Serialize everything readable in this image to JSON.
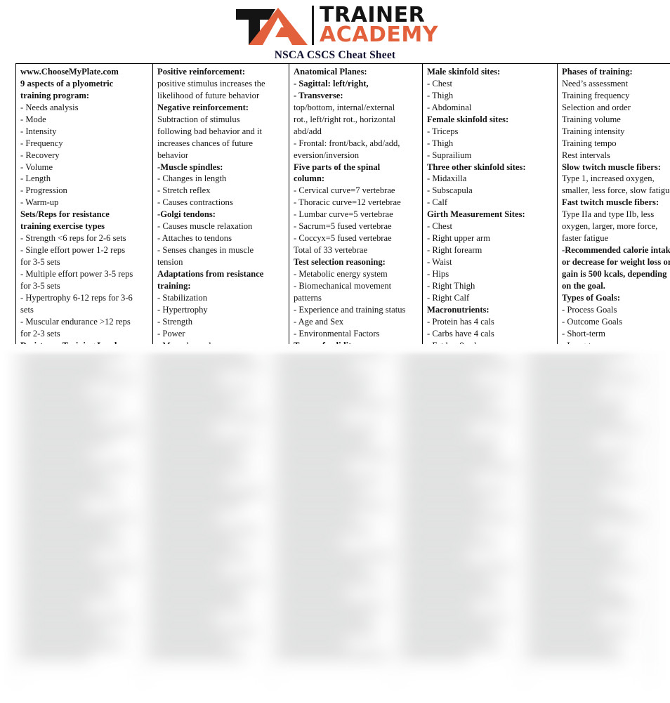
{
  "header": {
    "logo_icon": "trainer-academy-logo",
    "logo_word_1": "TRAINER",
    "logo_word_2": "ACADEMY",
    "subtitle": "NSCA CSCS Cheat Sheet",
    "brand_orange": "#e2613c",
    "brand_black": "#141414",
    "subtitle_color": "#101030"
  },
  "columns": [
    {
      "id": "column-1",
      "lines": [
        {
          "text": "www.ChooseMyPlate.com",
          "bold": true
        },
        {
          "text": "9 aspects of a plyometric",
          "bold": true
        },
        {
          "text": "training program:",
          "bold": true
        },
        {
          "text": "- Needs analysis",
          "bold": false
        },
        {
          "text": "- Mode",
          "bold": false
        },
        {
          "text": "- Intensity",
          "bold": false
        },
        {
          "text": "- Frequency",
          "bold": false
        },
        {
          "text": "- Recovery",
          "bold": false
        },
        {
          "text": "- Volume",
          "bold": false
        },
        {
          "text": "- Length",
          "bold": false
        },
        {
          "text": "- Progression",
          "bold": false
        },
        {
          "text": "- Warm-up",
          "bold": false
        },
        {
          "text": "Sets/Reps for resistance",
          "bold": true
        },
        {
          "text": "training exercise types",
          "bold": true
        },
        {
          "text": "- Strength <6 reps for 2-6 sets",
          "bold": false
        },
        {
          "text": "- Single effort power 1-2 reps",
          "bold": false
        },
        {
          "text": "for 3-5 sets",
          "bold": false
        },
        {
          "text": "- Multiple effort power 3-5 reps",
          "bold": false
        },
        {
          "text": "for 3-5 sets",
          "bold": false
        },
        {
          "text": "- Hypertrophy 6-12 reps for 3-6",
          "bold": false
        },
        {
          "text": "sets",
          "bold": false
        },
        {
          "text": "- Muscular endurance >12 reps",
          "bold": false
        },
        {
          "text": "for 2-3 sets",
          "bold": false
        },
        {
          "text": "Resistance Training Load",
          "bold": true
        },
        {
          "text": "- Strength >85% 1RM",
          "bold": false
        },
        {
          "text": "- Power single effort 80-90%",
          "bold": false
        },
        {
          "text": "1RM",
          "bold": false
        }
      ]
    },
    {
      "id": "column-2",
      "lines": [
        {
          "text": "Positive reinforcement:",
          "bold": true
        },
        {
          "text": "positive stimulus increases the",
          "bold": false
        },
        {
          "text": "likelihood of future behavior",
          "bold": false
        },
        {
          "text": "Negative reinforcement:",
          "bold": true
        },
        {
          "text": "Subtraction of stimulus",
          "bold": false
        },
        {
          "text": "following bad behavior and it",
          "bold": false
        },
        {
          "text": "increases chances of future",
          "bold": false
        },
        {
          "text": "behavior",
          "bold": false
        },
        {
          "text": "-Muscle spindles:",
          "bold": true
        },
        {
          "text": "- Changes in length",
          "bold": false
        },
        {
          "text": "- Stretch reflex",
          "bold": false
        },
        {
          "text": "- Causes contractions",
          "bold": false
        },
        {
          "text": "-Golgi tendons:",
          "bold": true
        },
        {
          "text": "- Causes muscle relaxation",
          "bold": false
        },
        {
          "text": "- Attaches to tendons",
          "bold": false
        },
        {
          "text": "- Senses changes in muscle",
          "bold": false
        },
        {
          "text": "tension",
          "bold": false
        },
        {
          "text": "Adaptations from resistance",
          "bold": true
        },
        {
          "text": "training:",
          "bold": true
        },
        {
          "text": "- Stabilization",
          "bold": false
        },
        {
          "text": "- Hypertrophy",
          "bold": false
        },
        {
          "text": "- Strength",
          "bold": false
        },
        {
          "text": "- Power",
          "bold": false
        },
        {
          "text": "- Muscular endurance",
          "bold": false
        },
        {
          "text": "Handgrip options",
          "bold": true
        },
        {
          "text": "- Pronated",
          "bold": false
        },
        {
          "text": "- Supinated",
          "bold": false
        }
      ]
    },
    {
      "id": "column-3",
      "lines": [
        {
          "text": "Anatomical Planes:",
          "bold": true
        },
        {
          "text": "- Sagittal: left/right,",
          "bold": true
        },
        {
          "text": "- Transverse:",
          "bold": true
        },
        {
          "text": "top/bottom, internal/external",
          "bold": false
        },
        {
          "text": "rot., left/right rot., horizontal",
          "bold": false
        },
        {
          "text": "abd/add",
          "bold": false
        },
        {
          "text": "- Frontal: front/back, abd/add,",
          "bold": false
        },
        {
          "text": "eversion/inversion",
          "bold": false
        },
        {
          "text": "Five parts of the spinal",
          "bold": true
        },
        {
          "text": "column:",
          "bold": true
        },
        {
          "text": "- Cervical curve=7 vertebrae",
          "bold": false
        },
        {
          "text": "- Thoracic curve=12 vertebrae",
          "bold": false
        },
        {
          "text": "- Lumbar curve=5 vertebrae",
          "bold": false
        },
        {
          "text": "- Sacrum=5 fused vertebrae",
          "bold": false
        },
        {
          "text": "- Coccyx=5 fused vertebrae",
          "bold": false
        },
        {
          "text": "Total of 33 vertebrae",
          "bold": false
        },
        {
          "text": "Test selection reasoning:",
          "bold": true
        },
        {
          "text": "- Metabolic energy system",
          "bold": false
        },
        {
          "text": "- Biomechanical movement",
          "bold": false
        },
        {
          "text": "patterns",
          "bold": false
        },
        {
          "text": "- Experience and training status",
          "bold": false
        },
        {
          "text": "- Age and Sex",
          "bold": false
        },
        {
          "text": "- Environmental Factors",
          "bold": false
        },
        {
          "text": "Types of validity:",
          "bold": true
        },
        {
          "text": "- Construct",
          "bold": false
        },
        {
          "text": "- Face",
          "bold": false
        },
        {
          "text": "- Content",
          "bold": false
        }
      ]
    },
    {
      "id": "column-4",
      "lines": [
        {
          "text": "Male skinfold sites:",
          "bold": true
        },
        {
          "text": "- Chest",
          "bold": false
        },
        {
          "text": "- Thigh",
          "bold": false
        },
        {
          "text": "- Abdominal",
          "bold": false
        },
        {
          "text": "Female skinfold sites:",
          "bold": true
        },
        {
          "text": "- Triceps",
          "bold": false
        },
        {
          "text": "- Thigh",
          "bold": false
        },
        {
          "text": "- Suprailium",
          "bold": false
        },
        {
          "text": "Three other skinfold sites:",
          "bold": true
        },
        {
          "text": "- Midaxilla",
          "bold": false
        },
        {
          "text": "- Subscapula",
          "bold": false
        },
        {
          "text": "- Calf",
          "bold": false
        },
        {
          "text": "Girth Measurement Sites:",
          "bold": true
        },
        {
          "text": "- Chest",
          "bold": false
        },
        {
          "text": "- Right upper arm",
          "bold": false
        },
        {
          "text": "- Right forearm",
          "bold": false
        },
        {
          "text": "- Waist",
          "bold": false
        },
        {
          "text": "- Hips",
          "bold": false
        },
        {
          "text": "- Right Thigh",
          "bold": false
        },
        {
          "text": "- Right Calf",
          "bold": false
        },
        {
          "text": "Macronutrients:",
          "bold": true
        },
        {
          "text": "- Protein has 4 cals",
          "bold": false
        },
        {
          "text": "- Carbs have 4 cals",
          "bold": false
        },
        {
          "text": "- Fat has 9 cals",
          "bold": false
        },
        {
          "text": "- Alcohol has 7 cals",
          "bold": false
        },
        {
          "text": "Chronic Adaptations to",
          "bold": true
        },
        {
          "text": "Aerobic Exercise",
          "bold": true
        }
      ]
    },
    {
      "id": "column-5",
      "lines": [
        {
          "text": "Phases of training:",
          "bold": true
        },
        {
          "text": "Need’s assessment",
          "bold": false
        },
        {
          "text": "Training frequency",
          "bold": false
        },
        {
          "text": "Selection and order",
          "bold": false
        },
        {
          "text": "Training volume",
          "bold": false
        },
        {
          "text": "Training intensity",
          "bold": false
        },
        {
          "text": "Training tempo",
          "bold": false
        },
        {
          "text": "Rest intervals",
          "bold": false
        },
        {
          "text": "Slow twitch muscle fibers:",
          "bold": true
        },
        {
          "text": "Type 1, increased oxygen,",
          "bold": false
        },
        {
          "text": "smaller, less force, slow fatigue",
          "bold": false
        },
        {
          "text": "Fast twitch muscle fibers:",
          "bold": true
        },
        {
          "text": "Type IIa and type IIb, less",
          "bold": false
        },
        {
          "text": "oxygen, larger, more force,",
          "bold": false
        },
        {
          "text": "faster fatigue",
          "bold": false
        },
        {
          "text": "-Recommended calorie intake",
          "bold": true
        },
        {
          "text": "or decrease for weight loss or",
          "bold": true
        },
        {
          "text": "gain is 500 kcals, depending",
          "bold": true
        },
        {
          "text": "on the goal.",
          "bold": true
        },
        {
          "text": "Types of Goals:",
          "bold": true
        },
        {
          "text": "- Process Goals",
          "bold": false
        },
        {
          "text": "- Outcome Goals",
          "bold": false
        },
        {
          "text": "- Short-term",
          "bold": false
        },
        {
          "text": "- Long-term",
          "bold": false
        },
        {
          "text": "Four physical relaxation",
          "bold": true
        },
        {
          "text": "techniques:",
          "bold": true
        },
        {
          "text": "- Diaphragmatic breathing",
          "bold": false
        }
      ]
    }
  ]
}
